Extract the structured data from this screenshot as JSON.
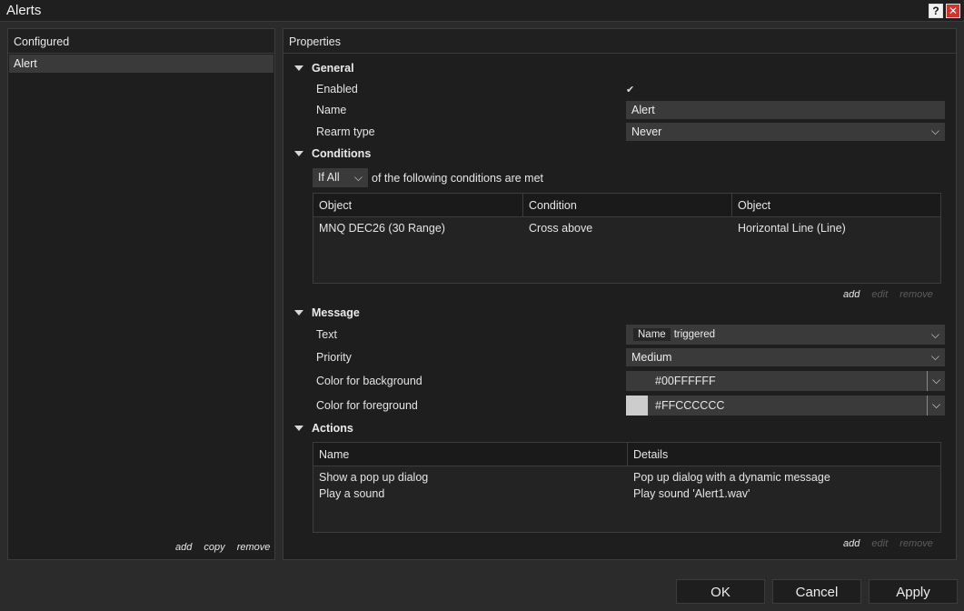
{
  "window": {
    "title": "Alerts",
    "help_label": "?",
    "close_label": "✕"
  },
  "configured": {
    "header": "Configured",
    "items": [
      "Alert"
    ],
    "links": {
      "add": "add",
      "copy": "copy",
      "remove": "remove"
    }
  },
  "properties": {
    "header": "Properties",
    "general": {
      "title": "General",
      "enabled_label": "Enabled",
      "enabled_value": "✔",
      "name_label": "Name",
      "name_value": "Alert",
      "rearm_label": "Rearm type",
      "rearm_value": "Never"
    },
    "conditions": {
      "title": "Conditions",
      "mode_value": "If All",
      "mode_suffix": "of the following conditions are met",
      "columns": [
        "Object",
        "Condition",
        "Object"
      ],
      "rows": [
        [
          "MNQ DEC26 (30 Range)",
          "Cross above",
          "Horizontal Line (Line)"
        ]
      ],
      "links": {
        "add": "add",
        "edit": "edit",
        "remove": "remove"
      }
    },
    "message": {
      "title": "Message",
      "text_label": "Text",
      "text_chip": "Name",
      "text_value": "triggered",
      "priority_label": "Priority",
      "priority_value": "Medium",
      "bg_label": "Color for background",
      "bg_value": "#00FFFFFF",
      "bg_swatch": "#3a3a3a",
      "fg_label": "Color for foreground",
      "fg_value": "#FFCCCCCC",
      "fg_swatch": "#cccccc"
    },
    "actions": {
      "title": "Actions",
      "columns": [
        "Name",
        "Details"
      ],
      "rows": [
        [
          "Show a pop up dialog",
          "Pop up dialog with a dynamic message"
        ],
        [
          "Play a sound",
          "Play sound 'Alert1.wav'"
        ]
      ],
      "links": {
        "add": "add",
        "edit": "edit",
        "remove": "remove"
      }
    }
  },
  "buttons": {
    "ok": "OK",
    "cancel": "Cancel",
    "apply": "Apply"
  }
}
